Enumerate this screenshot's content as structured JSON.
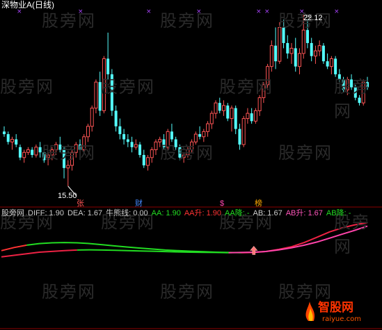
{
  "colors": {
    "bg": "#000000",
    "up": "#ff5555",
    "down": "#54ffff",
    "flat": "#cccccc",
    "diff_green": "#22dd22",
    "dea_red": "#ee2244",
    "dea_pink": "#ff44aa",
    "label_white": "#ffffff",
    "label_green": "#22dd22",
    "label_red": "#ff3333",
    "label_pink": "#ff55bb",
    "label_yellow": "#dddd22",
    "marker_purple": "#aa44ff"
  },
  "top": {
    "title": "深物业A(日线)",
    "high_label": "22.12",
    "low_label": "15.50",
    "event_tags": [
      {
        "text": "张",
        "color": "#ff5555"
      },
      {
        "text": "财",
        "color": "#4488ff"
      },
      {
        "text": "$",
        "color": "#ff44aa"
      },
      {
        "text": "榜",
        "color": "#ffaa00"
      }
    ]
  },
  "indicator": {
    "items": [
      {
        "text": "股旁网",
        "color": "#cccccc"
      },
      {
        "text": "DIFF: 1.90",
        "color": "#cccccc"
      },
      {
        "text": "DEA: 1.67",
        "color": "#cccccc"
      },
      {
        "text": "牛熊线: 0.00",
        "color": "#cccccc"
      },
      {
        "text": "AA: 1.90",
        "color": "#22dd22"
      },
      {
        "text": "AA升: 1.90",
        "color": "#ff3333"
      },
      {
        "text": "AA降: -",
        "color": "#22dd22"
      },
      {
        "text": "AB: 1.67",
        "color": "#cccccc"
      },
      {
        "text": "AB升: 1.67",
        "color": "#ff55bb"
      },
      {
        "text": "AB降: -",
        "color": "#22dd22"
      }
    ]
  },
  "watermark": "股旁网",
  "brand": {
    "name": "智股网",
    "url": "raiyue.com"
  },
  "chart_data": {
    "type": "candlestick",
    "price_high": 22.12,
    "price_low": 15.5,
    "candles": [
      [
        17.6,
        17.8,
        17.4,
        17.5
      ],
      [
        17.5,
        17.6,
        17.1,
        17.2
      ],
      [
        17.2,
        17.4,
        16.9,
        17.3
      ],
      [
        17.3,
        17.5,
        17.0,
        17.1
      ],
      [
        17.0,
        17.1,
        16.5,
        16.6
      ],
      [
        16.6,
        16.9,
        16.4,
        16.8
      ],
      [
        16.8,
        17.0,
        16.7,
        16.9
      ],
      [
        16.9,
        17.0,
        16.6,
        16.7
      ],
      [
        16.7,
        17.1,
        16.6,
        17.0
      ],
      [
        17.0,
        17.2,
        16.6,
        16.8
      ],
      [
        16.8,
        16.9,
        16.4,
        16.5
      ],
      [
        16.6,
        16.8,
        16.3,
        16.7
      ],
      [
        16.7,
        17.0,
        16.5,
        16.9
      ],
      [
        16.9,
        17.2,
        16.7,
        17.1
      ],
      [
        17.1,
        17.4,
        16.8,
        16.9
      ],
      [
        16.9,
        17.0,
        15.8,
        16.2
      ],
      [
        16.2,
        16.5,
        15.5,
        16.3
      ],
      [
        16.3,
        16.9,
        16.1,
        16.8
      ],
      [
        16.8,
        17.2,
        16.6,
        17.1
      ],
      [
        17.1,
        17.3,
        16.8,
        16.9
      ],
      [
        16.9,
        17.5,
        16.8,
        17.4
      ],
      [
        17.4,
        17.9,
        17.2,
        17.8
      ],
      [
        17.8,
        18.6,
        17.6,
        18.5
      ],
      [
        18.5,
        19.6,
        18.3,
        19.5
      ],
      [
        19.5,
        19.9,
        18.2,
        18.4
      ],
      [
        18.4,
        20.5,
        18.3,
        20.4
      ],
      [
        20.4,
        21.4,
        19.6,
        19.8
      ],
      [
        19.8,
        20.0,
        18.2,
        18.4
      ],
      [
        18.4,
        18.6,
        17.6,
        17.8
      ],
      [
        17.8,
        18.1,
        17.3,
        17.5
      ],
      [
        17.5,
        17.7,
        17.1,
        17.3
      ],
      [
        17.3,
        17.5,
        17.0,
        17.2
      ],
      [
        17.2,
        17.4,
        16.8,
        17.0
      ],
      [
        17.0,
        17.3,
        16.9,
        17.1
      ],
      [
        17.1,
        17.2,
        16.6,
        16.7
      ],
      [
        16.7,
        16.9,
        16.2,
        16.3
      ],
      [
        16.3,
        16.7,
        16.1,
        16.6
      ],
      [
        16.6,
        17.0,
        16.4,
        16.9
      ],
      [
        16.9,
        17.3,
        16.7,
        17.2
      ],
      [
        17.2,
        17.4,
        17.0,
        17.3
      ],
      [
        17.3,
        17.5,
        16.9,
        17.0
      ],
      [
        17.0,
        17.7,
        16.9,
        17.6
      ],
      [
        17.6,
        17.9,
        17.2,
        17.3
      ],
      [
        17.3,
        17.4,
        16.9,
        17.0
      ],
      [
        17.0,
        17.1,
        16.5,
        16.6
      ],
      [
        16.6,
        16.8,
        16.4,
        16.7
      ],
      [
        16.7,
        17.0,
        16.6,
        16.9
      ],
      [
        16.9,
        17.3,
        16.8,
        17.2
      ],
      [
        17.2,
        17.6,
        17.1,
        17.5
      ],
      [
        17.5,
        17.8,
        17.3,
        17.4
      ],
      [
        17.4,
        17.7,
        17.2,
        17.6
      ],
      [
        17.6,
        18.0,
        17.4,
        17.9
      ],
      [
        17.9,
        18.4,
        17.7,
        18.3
      ],
      [
        18.3,
        18.8,
        18.1,
        18.7
      ],
      [
        18.7,
        18.9,
        18.3,
        18.4
      ],
      [
        18.4,
        18.8,
        18.2,
        18.6
      ],
      [
        18.6,
        18.7,
        18.0,
        18.1
      ],
      [
        18.1,
        18.6,
        17.6,
        18.5
      ],
      [
        18.5,
        18.6,
        17.5,
        17.7
      ],
      [
        17.7,
        17.9,
        16.9,
        17.1
      ],
      [
        17.1,
        18.2,
        17.0,
        18.1
      ],
      [
        18.1,
        18.5,
        17.9,
        18.3
      ],
      [
        18.3,
        18.5,
        17.9,
        18.0
      ],
      [
        18.0,
        18.5,
        17.9,
        18.4
      ],
      [
        18.4,
        19.0,
        18.2,
        18.9
      ],
      [
        18.9,
        19.5,
        18.7,
        19.4
      ],
      [
        19.4,
        20.2,
        19.2,
        20.1
      ],
      [
        20.1,
        21.1,
        19.9,
        20.9
      ],
      [
        20.9,
        21.6,
        20.0,
        20.3
      ],
      [
        20.3,
        21.8,
        20.2,
        21.6
      ],
      [
        21.6,
        21.9,
        20.8,
        21.0
      ],
      [
        21.0,
        21.3,
        20.4,
        20.6
      ],
      [
        20.6,
        21.0,
        20.2,
        20.8
      ],
      [
        20.8,
        21.2,
        19.9,
        20.1
      ],
      [
        20.1,
        20.8,
        19.8,
        20.6
      ],
      [
        20.6,
        22.12,
        20.4,
        21.5
      ],
      [
        21.5,
        21.9,
        20.8,
        21.0
      ],
      [
        21.0,
        21.2,
        20.3,
        20.5
      ],
      [
        20.5,
        20.9,
        20.2,
        20.7
      ],
      [
        20.7,
        21.1,
        20.5,
        20.9
      ],
      [
        20.9,
        21.0,
        20.2,
        20.3
      ],
      [
        20.3,
        20.6,
        20.0,
        20.1
      ],
      [
        20.1,
        20.5,
        19.8,
        20.4
      ],
      [
        20.4,
        20.5,
        19.7,
        19.8
      ],
      [
        19.8,
        20.0,
        19.5,
        19.6
      ],
      [
        19.6,
        19.7,
        19.1,
        19.2
      ],
      [
        19.2,
        19.7,
        19.0,
        19.6
      ],
      [
        19.6,
        19.8,
        19.2,
        19.3
      ],
      [
        19.3,
        19.4,
        18.8,
        18.9
      ],
      [
        18.9,
        19.0,
        18.6,
        18.7
      ],
      [
        18.7,
        19.6,
        18.6,
        19.5
      ],
      [
        19.5,
        19.7,
        19.2,
        19.3
      ]
    ],
    "DIFF": 1.9,
    "DEA": 1.67,
    "diff_series": [
      0.1,
      0.3,
      0.45,
      0.55,
      0.6,
      0.62,
      0.6,
      0.55,
      0.48,
      0.4,
      0.33,
      0.26,
      0.2,
      0.14,
      0.1,
      0.06,
      0.03,
      0.0,
      -0.02,
      -0.03,
      -0.02,
      0.05,
      0.18,
      0.35,
      0.62,
      0.95,
      1.3,
      1.55,
      1.75,
      1.9
    ],
    "dea_series": [
      -0.3,
      -0.2,
      -0.1,
      0.0,
      0.05,
      0.1,
      0.14,
      0.15,
      0.14,
      0.12,
      0.1,
      0.08,
      0.06,
      0.04,
      0.02,
      0.0,
      -0.01,
      -0.02,
      -0.03,
      -0.02,
      0.0,
      0.05,
      0.15,
      0.28,
      0.45,
      0.65,
      0.9,
      1.15,
      1.4,
      1.67
    ]
  }
}
